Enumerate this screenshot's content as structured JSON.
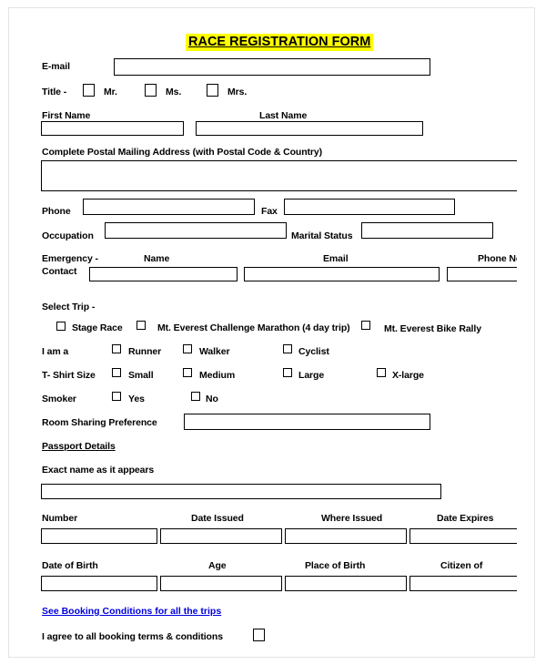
{
  "document": {
    "title": "RACE REGISTRATION FORM"
  },
  "contact": {
    "email_label": "E-mail",
    "email_value": "",
    "title_label": "Title -",
    "title_options": [
      "Mr.",
      "Ms.",
      "Mrs."
    ],
    "first_name_label": "First Name",
    "first_name_value": "",
    "last_name_label": "Last Name",
    "last_name_value": "",
    "address_label": "Complete Postal Mailing Address (with Postal Code & Country)",
    "address_value": "",
    "phone_label": "Phone",
    "phone_value": "",
    "fax_label": "Fax",
    "fax_value": "",
    "occupation_label": "Occupation",
    "occupation_value": "",
    "marital_status_label": "Marital Status",
    "marital_status_value": ""
  },
  "emergency": {
    "label_line1": "Emergency -",
    "label_line2": "Contact",
    "name_label": "Name",
    "name_value": "",
    "email_label": "Email",
    "email_value": "",
    "phone_label": "Phone No",
    "phone_value": ""
  },
  "trip": {
    "label": "Select Trip -",
    "options": [
      "Stage Race",
      "Mt. Everest Challenge Marathon (4 day trip)",
      "Mt. Everest Bike Rally"
    ]
  },
  "participant": {
    "label": "I am a",
    "options": [
      "Runner",
      "Walker",
      "Cyclist"
    ]
  },
  "tshirt": {
    "label": "T- Shirt Size",
    "options": [
      "Small",
      "Medium",
      "Large",
      "X-large"
    ]
  },
  "smoker": {
    "label": "Smoker",
    "options": [
      "Yes",
      "No"
    ]
  },
  "room_sharing": {
    "label": "Room Sharing Preference",
    "value": ""
  },
  "passport": {
    "section_heading": "Passport Details",
    "exact_name_label": "Exact name as it appears",
    "exact_name_value": "",
    "row1_headers": [
      "Number",
      "Date Issued",
      "Where Issued",
      "Date Expires"
    ],
    "row1_values": [
      "",
      "",
      "",
      ""
    ],
    "row2_headers": [
      "Date of Birth",
      "Age",
      "Place of Birth",
      "Citizen of"
    ],
    "row2_values": [
      "",
      "",
      "",
      ""
    ]
  },
  "footer": {
    "booking_link": "See Booking Conditions for all the trips",
    "agree_label": "I agree to all booking terms & conditions"
  },
  "colors": {
    "highlight": "#ffff00",
    "link": "#0000dd",
    "ink": "#000000"
  }
}
